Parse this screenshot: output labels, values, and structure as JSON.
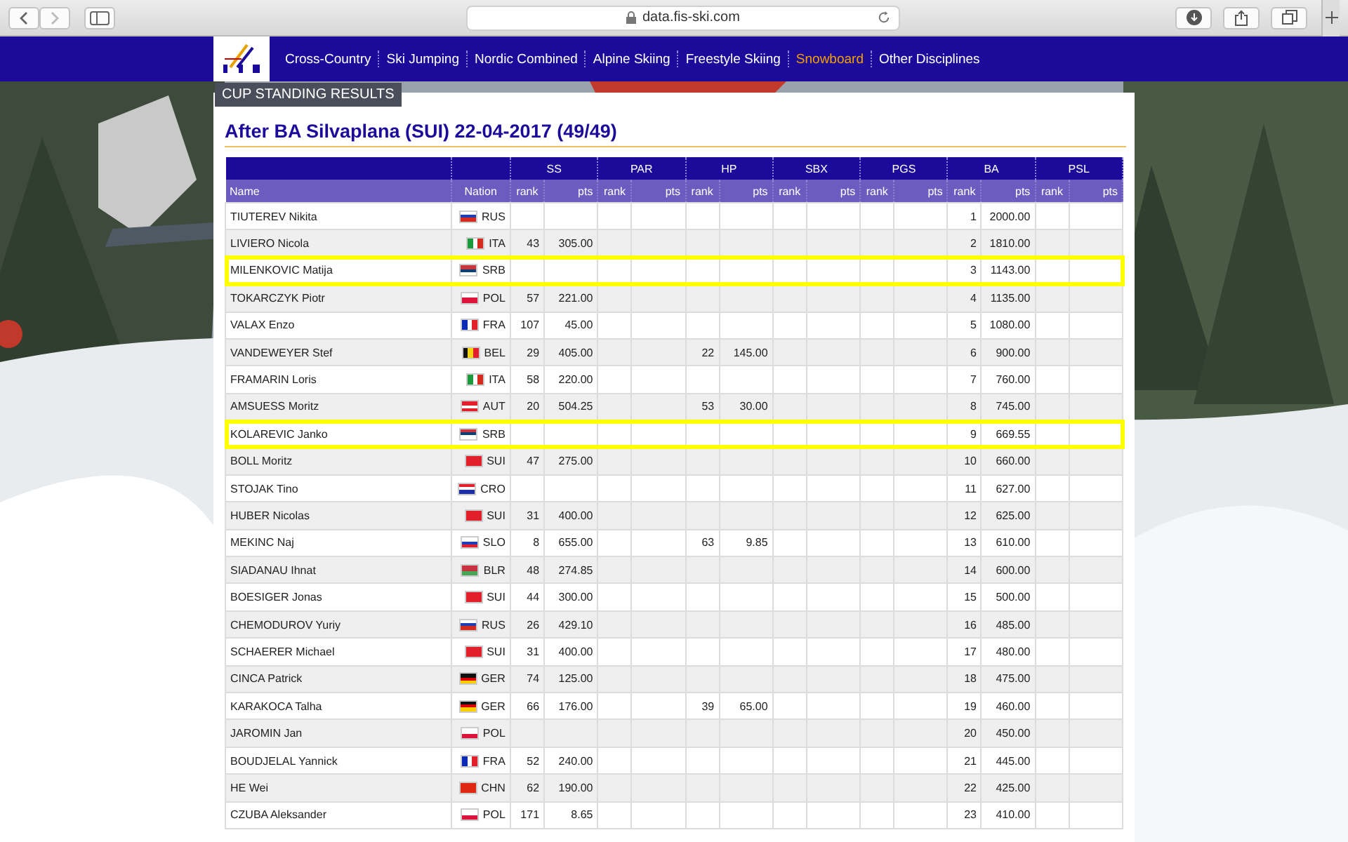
{
  "browser": {
    "address": "data.fis-ski.com"
  },
  "nav": {
    "items": [
      {
        "label": "Cross-Country",
        "selected": false
      },
      {
        "label": "Ski Jumping",
        "selected": false
      },
      {
        "label": "Nordic Combined",
        "selected": false
      },
      {
        "label": "Alpine Skiing",
        "selected": false
      },
      {
        "label": "Freestyle Skiing",
        "selected": false
      },
      {
        "label": "Snowboard",
        "selected": true
      },
      {
        "label": "Other Disciplines",
        "selected": false
      }
    ]
  },
  "section_tab": "CUP STANDING RESULTS",
  "title": "After BA Silvaplana (SUI) 22-04-2017 (49/49)",
  "table": {
    "name_header": "Name",
    "nation_header": "Nation",
    "disciplines": [
      {
        "label": "SS",
        "rank_header": "rank",
        "pts_header": "pts"
      },
      {
        "label": "PAR",
        "rank_header": "rank",
        "pts_header": "pts"
      },
      {
        "label": "HP",
        "rank_header": "rank",
        "pts_header": "pts"
      },
      {
        "label": "SBX",
        "rank_header": "rank",
        "pts_header": "pts"
      },
      {
        "label": "PGS",
        "rank_header": "rank",
        "pts_header": "pts"
      },
      {
        "label": "BA",
        "rank_header": "rank",
        "pts_header": "pts"
      },
      {
        "label": "PSL",
        "rank_header": "rank",
        "pts_header": "pts"
      }
    ],
    "rows": [
      {
        "name": "TIUTEREV Nikita",
        "nation": "RUS",
        "highlighted": false,
        "ba": {
          "rank": "1",
          "pts": "2000.00"
        }
      },
      {
        "name": "LIVIERO Nicola",
        "nation": "ITA",
        "highlighted": false,
        "ss": {
          "rank": "43",
          "pts": "305.00"
        },
        "ba": {
          "rank": "2",
          "pts": "1810.00"
        }
      },
      {
        "name": "MILENKOVIC Matija",
        "nation": "SRB",
        "highlighted": true,
        "ba": {
          "rank": "3",
          "pts": "1143.00"
        }
      },
      {
        "name": "TOKARCZYK Piotr",
        "nation": "POL",
        "highlighted": false,
        "ss": {
          "rank": "57",
          "pts": "221.00"
        },
        "ba": {
          "rank": "4",
          "pts": "1135.00"
        }
      },
      {
        "name": "VALAX Enzo",
        "nation": "FRA",
        "highlighted": false,
        "ss": {
          "rank": "107",
          "pts": "45.00"
        },
        "ba": {
          "rank": "5",
          "pts": "1080.00"
        }
      },
      {
        "name": "VANDEWEYER Stef",
        "nation": "BEL",
        "highlighted": false,
        "ss": {
          "rank": "29",
          "pts": "405.00"
        },
        "hp": {
          "rank": "22",
          "pts": "145.00"
        },
        "ba": {
          "rank": "6",
          "pts": "900.00"
        }
      },
      {
        "name": "FRAMARIN Loris",
        "nation": "ITA",
        "highlighted": false,
        "ss": {
          "rank": "58",
          "pts": "220.00"
        },
        "ba": {
          "rank": "7",
          "pts": "760.00"
        }
      },
      {
        "name": "AMSUESS Moritz",
        "nation": "AUT",
        "highlighted": false,
        "ss": {
          "rank": "20",
          "pts": "504.25"
        },
        "hp": {
          "rank": "53",
          "pts": "30.00"
        },
        "ba": {
          "rank": "8",
          "pts": "745.00"
        }
      },
      {
        "name": "KOLAREVIC Janko",
        "nation": "SRB",
        "highlighted": true,
        "ba": {
          "rank": "9",
          "pts": "669.55"
        }
      },
      {
        "name": "BOLL Moritz",
        "nation": "SUI",
        "highlighted": false,
        "ss": {
          "rank": "47",
          "pts": "275.00"
        },
        "ba": {
          "rank": "10",
          "pts": "660.00"
        }
      },
      {
        "name": "STOJAK Tino",
        "nation": "CRO",
        "highlighted": false,
        "ba": {
          "rank": "11",
          "pts": "627.00"
        }
      },
      {
        "name": "HUBER Nicolas",
        "nation": "SUI",
        "highlighted": false,
        "ss": {
          "rank": "31",
          "pts": "400.00"
        },
        "ba": {
          "rank": "12",
          "pts": "625.00"
        }
      },
      {
        "name": "MEKINC Naj",
        "nation": "SLO",
        "highlighted": false,
        "ss": {
          "rank": "8",
          "pts": "655.00"
        },
        "hp": {
          "rank": "63",
          "pts": "9.85"
        },
        "ba": {
          "rank": "13",
          "pts": "610.00"
        }
      },
      {
        "name": "SIADANAU Ihnat",
        "nation": "BLR",
        "highlighted": false,
        "ss": {
          "rank": "48",
          "pts": "274.85"
        },
        "ba": {
          "rank": "14",
          "pts": "600.00"
        }
      },
      {
        "name": "BOESIGER Jonas",
        "nation": "SUI",
        "highlighted": false,
        "ss": {
          "rank": "44",
          "pts": "300.00"
        },
        "ba": {
          "rank": "15",
          "pts": "500.00"
        }
      },
      {
        "name": "CHEMODUROV Yuriy",
        "nation": "RUS",
        "highlighted": false,
        "ss": {
          "rank": "26",
          "pts": "429.10"
        },
        "ba": {
          "rank": "16",
          "pts": "485.00"
        }
      },
      {
        "name": "SCHAERER Michael",
        "nation": "SUI",
        "highlighted": false,
        "ss": {
          "rank": "31",
          "pts": "400.00"
        },
        "ba": {
          "rank": "17",
          "pts": "480.00"
        }
      },
      {
        "name": "CINCA Patrick",
        "nation": "GER",
        "highlighted": false,
        "ss": {
          "rank": "74",
          "pts": "125.00"
        },
        "ba": {
          "rank": "18",
          "pts": "475.00"
        }
      },
      {
        "name": "KARAKOCA Talha",
        "nation": "GER",
        "highlighted": false,
        "ss": {
          "rank": "66",
          "pts": "176.00"
        },
        "hp": {
          "rank": "39",
          "pts": "65.00"
        },
        "ba": {
          "rank": "19",
          "pts": "460.00"
        }
      },
      {
        "name": "JAROMIN Jan",
        "nation": "POL",
        "highlighted": false,
        "ba": {
          "rank": "20",
          "pts": "450.00"
        }
      },
      {
        "name": "BOUDJELAL Yannick",
        "nation": "FRA",
        "highlighted": false,
        "ss": {
          "rank": "52",
          "pts": "240.00"
        },
        "ba": {
          "rank": "21",
          "pts": "445.00"
        }
      },
      {
        "name": "HE Wei",
        "nation": "CHN",
        "highlighted": false,
        "ss": {
          "rank": "62",
          "pts": "190.00"
        },
        "ba": {
          "rank": "22",
          "pts": "425.00"
        }
      },
      {
        "name": "CZUBA Aleksander",
        "nation": "POL",
        "highlighted": false,
        "ss": {
          "rank": "171",
          "pts": "8.65"
        },
        "ba": {
          "rank": "23",
          "pts": "410.00"
        }
      }
    ]
  }
}
